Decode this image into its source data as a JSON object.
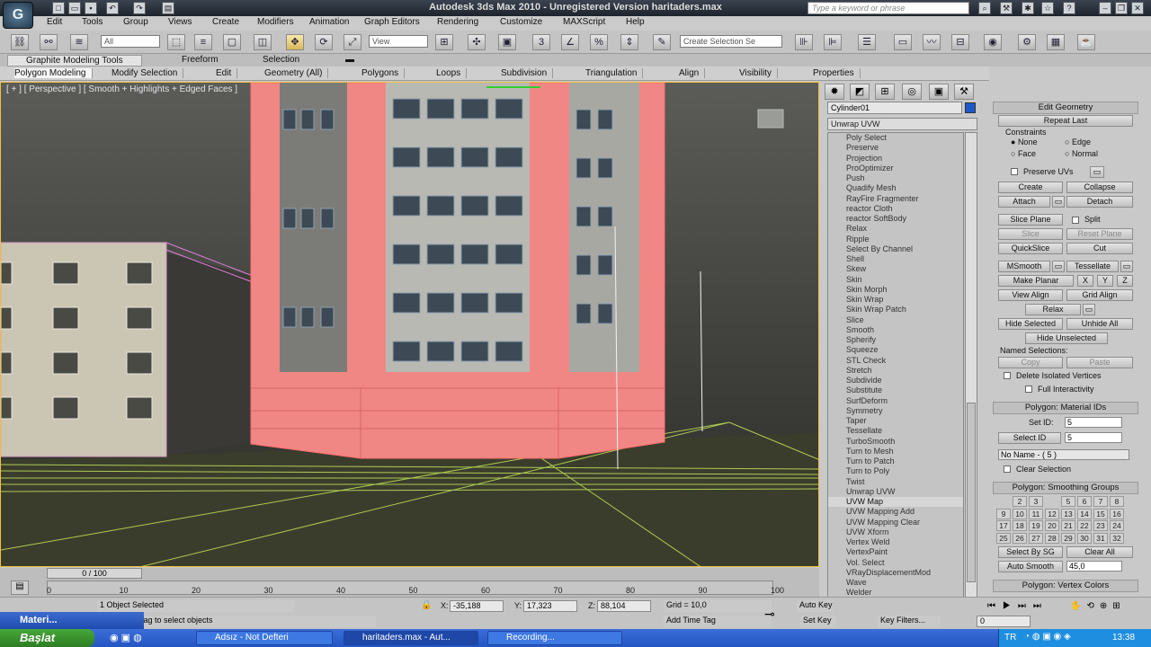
{
  "app": {
    "title": "Autodesk 3ds Max  2010   - Unregistered Version    haritaders.max",
    "logo": "G",
    "search_placeholder": "Type a keyword or phrase"
  },
  "menu": [
    "Edit",
    "Tools",
    "Group",
    "Views",
    "Create",
    "Modifiers",
    "Animation",
    "Graph Editors",
    "Rendering",
    "Customize",
    "MAXScript",
    "Help"
  ],
  "toolbar": {
    "selection_filter": "All",
    "reference_coord": "View",
    "named_selection": "Create Selection Se"
  },
  "ribbon": {
    "tabs": [
      "Graphite Modeling Tools",
      "Freeform",
      "Selection"
    ],
    "panels": [
      "Polygon Modeling",
      "Modify Selection",
      "Edit",
      "Geometry (All)",
      "Polygons",
      "Loops",
      "Subdivision",
      "Triangulation",
      "Align",
      "Visibility",
      "Properties"
    ]
  },
  "viewport": {
    "label": "[ + ] [ Perspective ] [ Smooth + Highlights + Edged Faces ]"
  },
  "command_panel": {
    "object_name": "Cylinder01",
    "object_color": "#1c59c8",
    "modifier_dropdown": "Unwrap UVW",
    "modifiers": [
      "Poly Select",
      "Preserve",
      "Projection",
      "ProOptimizer",
      "Push",
      "Quadify Mesh",
      "RayFire Fragmenter",
      "reactor Cloth",
      "reactor SoftBody",
      "Relax",
      "Ripple",
      "Select By Channel",
      "Shell",
      "Skew",
      "Skin",
      "Skin Morph",
      "Skin Wrap",
      "Skin Wrap Patch",
      "Slice",
      "Smooth",
      "Spherify",
      "Squeeze",
      "STL Check",
      "Stretch",
      "Subdivide",
      "Substitute",
      "SurfDeform",
      "Symmetry",
      "Taper",
      "Tessellate",
      "TurboSmooth",
      "Turn to Mesh",
      "Turn to Patch",
      "Turn to Poly",
      "Twist",
      "Unwrap UVW",
      "UVW Map",
      "UVW Mapping Add",
      "UVW Mapping Clear",
      "UVW Xform",
      "Vertex Weld",
      "VertexPaint",
      "Vol. Select",
      "VRayDisplacementMod",
      "Wave",
      "Welder",
      "XForm"
    ],
    "selected_modifier_index": 36,
    "edit_geometry": {
      "title": "Edit Geometry",
      "repeat_last": "Repeat Last",
      "constraints": "Constraints",
      "none": "None",
      "edge": "Edge",
      "face": "Face",
      "normal": "Normal",
      "preserve_uvs": "Preserve UVs",
      "create": "Create",
      "collapse": "Collapse",
      "attach": "Attach",
      "detach": "Detach",
      "slice_plane": "Slice Plane",
      "split": "Split",
      "slice": "Slice",
      "reset_plane": "Reset Plane",
      "quickslice": "QuickSlice",
      "cut": "Cut",
      "msmooth": "MSmooth",
      "tessellate": "Tessellate",
      "make_planar": "Make Planar",
      "x": "X",
      "y": "Y",
      "z": "Z",
      "view_align": "View Align",
      "grid_align": "Grid Align",
      "relax": "Relax",
      "hide_selected": "Hide Selected",
      "unhide_all": "Unhide All",
      "hide_unselected": "Hide Unselected",
      "named_selections": "Named Selections:",
      "copy": "Copy",
      "paste": "Paste",
      "delete_isolated": "Delete Isolated Vertices",
      "full_interactivity": "Full Interactivity"
    },
    "material_ids": {
      "title": "Polygon: Material IDs",
      "set_id_label": "Set ID:",
      "set_id_value": "5",
      "select_id_button": "Select ID",
      "select_id_value": "5",
      "name_dropdown": "No Name - ( 5 )",
      "clear_selection": "Clear Selection"
    },
    "smoothing_groups": {
      "title": "Polygon: Smoothing Groups",
      "numbers": [
        "2",
        "3",
        "5",
        "6",
        "7",
        "8",
        "9",
        "10",
        "11",
        "12",
        "13",
        "14",
        "15",
        "16",
        "17",
        "18",
        "19",
        "20",
        "21",
        "22",
        "23",
        "24",
        "25",
        "26",
        "27",
        "28",
        "29",
        "30",
        "31",
        "32"
      ],
      "select_by_sg": "Select By SG",
      "clear_all": "Clear All",
      "auto_smooth": "Auto Smooth",
      "auto_smooth_value": "45,0"
    },
    "vertex_colors": {
      "title": "Polygon: Vertex Colors"
    }
  },
  "timeline": {
    "slider": "0 / 100",
    "ticks": [
      "0",
      "10",
      "20",
      "30",
      "40",
      "50",
      "60",
      "70",
      "80",
      "90",
      "100"
    ]
  },
  "status": {
    "selected": "1 Object Selected",
    "prompt": "Click-and-drag to select objects",
    "x_label": "X:",
    "x": "-35,188",
    "y_label": "Y:",
    "y": "17,323",
    "z_label": "Z:",
    "z": "88,104",
    "grid": "Grid = 10,0",
    "add_time_tag": "Add Time Tag",
    "auto_key": "Auto Key",
    "set_key": "Set Key",
    "key_filters": "Key Filters...",
    "frame": "0"
  },
  "mini_window": {
    "label": "Materi..."
  },
  "taskbar": {
    "start": "Başlat",
    "tasks": [
      "Adsız - Not Defteri",
      "haritaders.max - Aut...",
      "Recording..."
    ],
    "lang": "TR",
    "clock": "13:38"
  }
}
